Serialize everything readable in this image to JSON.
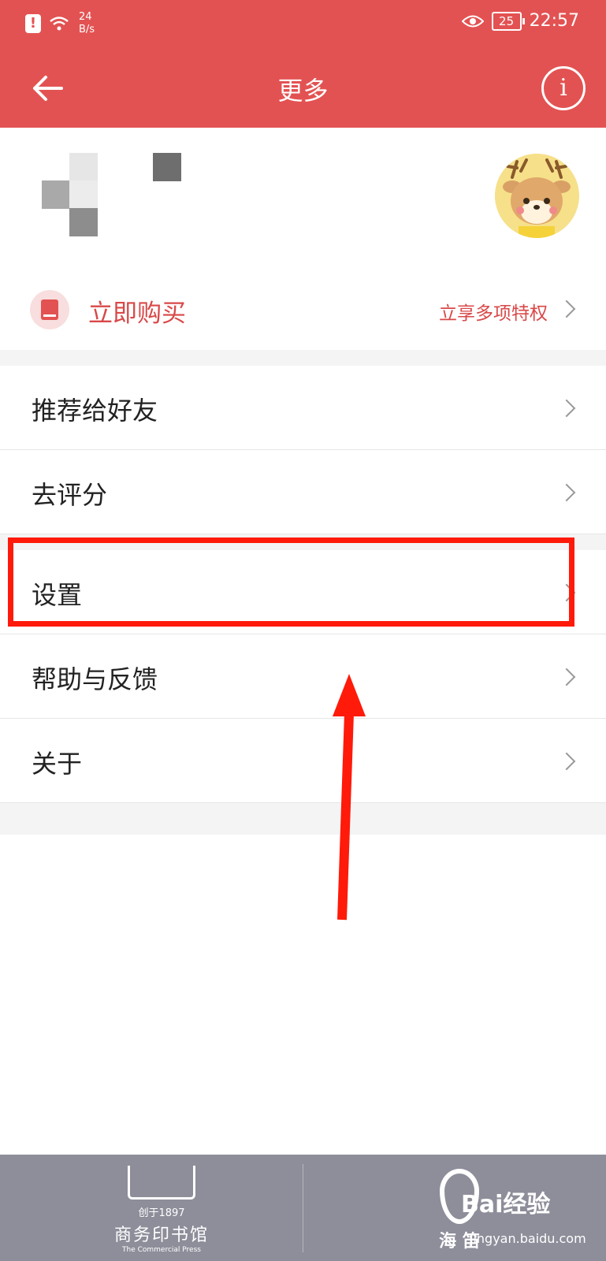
{
  "status_bar": {
    "net_speed_value": "24",
    "net_speed_unit": "B/s",
    "battery": "25",
    "time": "22:57"
  },
  "toolbar": {
    "title": "更多"
  },
  "vip": {
    "label": "立即购买",
    "subtitle": "立享多项特权"
  },
  "menu": [
    {
      "label": "推荐给好友"
    },
    {
      "label": "去评分"
    },
    {
      "label": "设置"
    },
    {
      "label": "帮助与反馈"
    },
    {
      "label": "关于"
    }
  ],
  "footer": {
    "left_year": "创于1897",
    "left_name": "商务印书馆",
    "left_en": "The Commercial Press",
    "right_name": "海 笛",
    "watermark": "Bai经验",
    "watermark_url": "jingyan.baidu.com"
  },
  "colors": {
    "accent": "#e35252",
    "highlight": "#ff1a0a"
  }
}
